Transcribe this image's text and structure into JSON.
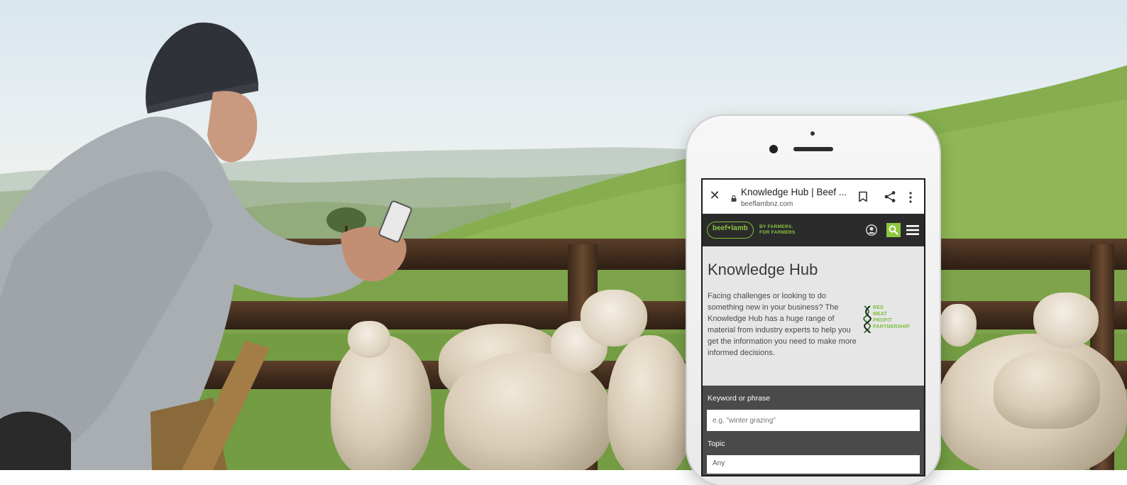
{
  "browser": {
    "tab_title": "Knowledge Hub | Beef ...",
    "url": "beeflambnz.com"
  },
  "site": {
    "logo_text": "beef+lamb",
    "tagline_line1": "BY FARMERS.",
    "tagline_line2": "FOR FARMERS",
    "brand_color": "#8cc63f",
    "header_color": "#2b2b2b"
  },
  "page": {
    "heading": "Knowledge Hub",
    "intro": "Facing challenges or looking to do something new in your business? The Knowledge Hub has a huge range of material from industry experts to help you get the information you need to make more informed decisions.",
    "partner_logo": {
      "line1": "RED",
      "line2": "MEAT",
      "line3": "PROFIT",
      "line4": "PARTNERSHIP"
    }
  },
  "search": {
    "keyword_label": "Keyword or phrase",
    "keyword_placeholder": "e.g. \"winter grazing\"",
    "topic_label": "Topic",
    "topic_value": "Any"
  },
  "icons": [
    "close-icon",
    "lock-icon",
    "bookmark-icon",
    "share-icon",
    "more-vert-icon",
    "user-icon",
    "search-icon",
    "menu-icon"
  ]
}
